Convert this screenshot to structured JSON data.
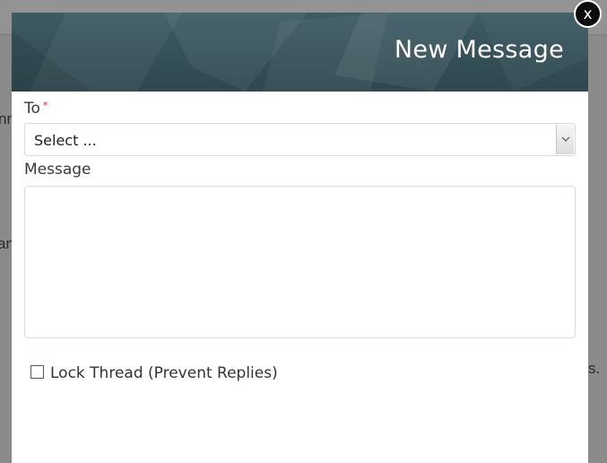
{
  "background": {
    "fragment_1": "nn",
    "fragment_2": "an",
    "fragment_3": "s."
  },
  "modal": {
    "title": "New Message",
    "close_label": "x",
    "to_label": "To",
    "required_marker": "*",
    "to_select_value": "Select ...",
    "message_label": "Message",
    "message_value": "",
    "lock_thread_label": "Lock Thread (Prevent Replies)",
    "lock_thread_checked": false
  },
  "colors": {
    "header": "#34505a",
    "close_button": "#0c0c0c"
  }
}
